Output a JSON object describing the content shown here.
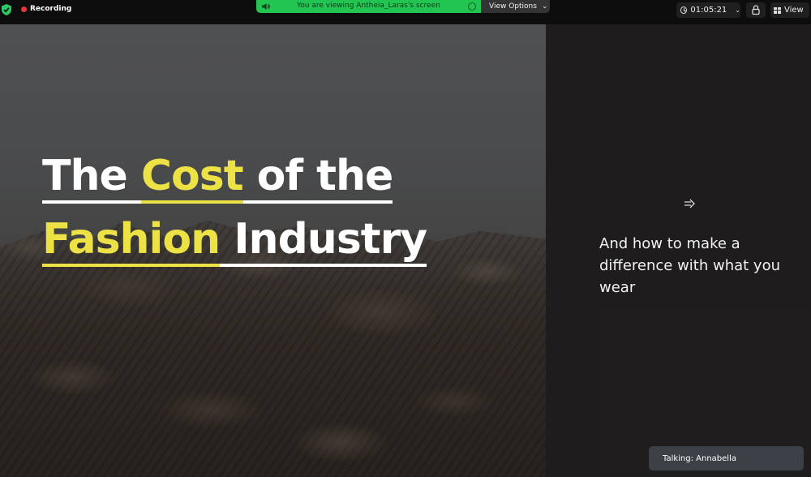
{
  "topbar": {
    "recording_label": "Recording",
    "share_banner_text": "You are viewing Antheia_Laras's screen",
    "view_options_label": "View Options",
    "timer_value": "01:05:21",
    "view_label": "View",
    "icons": {
      "shield": "shield-check-icon",
      "record": "record-dot-icon",
      "speaker": "speaker-icon",
      "stop": "circle-icon",
      "chevron": "chevron-down-icon",
      "clock": "clock-icon",
      "lock": "lock-icon",
      "view": "grid-icon"
    },
    "colors": {
      "banner_green": "#23c552",
      "record_red": "#e5363b",
      "shield_green": "#2ec866"
    }
  },
  "slide": {
    "title_line1": {
      "part1": "The ",
      "part2": "Cost",
      "part3": " of the"
    },
    "title_line2": {
      "part1": "Fashion",
      "part2": " Industry"
    },
    "subtitle": "And how to make a difference with what you wear",
    "arrow_icon": "arrow-right-icon",
    "colors": {
      "highlight_yellow": "#ece245",
      "text_white": "#ffffff"
    }
  },
  "status": {
    "talking_label": "Talking: Annabella"
  }
}
